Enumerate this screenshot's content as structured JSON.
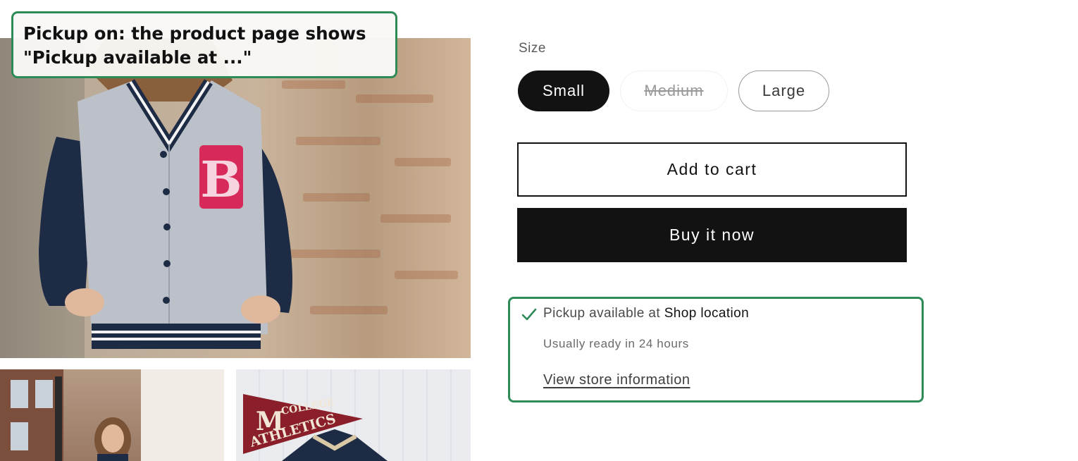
{
  "annotation": {
    "line1": "Pickup on: the product page shows",
    "line2": "\"Pickup available at ...\"",
    "border_color": "#2e8b57"
  },
  "product": {
    "media": {
      "main_image_icon": "varsity-jacket-photo",
      "thumb_1_icon": "woman-street-photo",
      "thumb_2_icon": "college-pennant-photo",
      "patch_letter": "B",
      "pennant_letter": "M",
      "pennant_line_1": "COLLEGE",
      "pennant_line_2": "ATHLETICS"
    },
    "size_label": "Size",
    "sizes": [
      {
        "label": "Small",
        "selected": true,
        "available": true
      },
      {
        "label": "Medium",
        "selected": false,
        "available": false
      },
      {
        "label": "Large",
        "selected": false,
        "available": true
      }
    ],
    "add_to_cart_label": "Add to cart",
    "buy_now_label": "Buy it now"
  },
  "pickup": {
    "check_icon": "checkmark-icon",
    "available_prefix": "Pickup available at ",
    "location_name": "Shop location",
    "ready_text": "Usually ready in 24 hours",
    "link_label": "View store information"
  },
  "colors": {
    "primary": "#121212",
    "highlight": "#2e8b57",
    "check": "#2e8b57"
  }
}
